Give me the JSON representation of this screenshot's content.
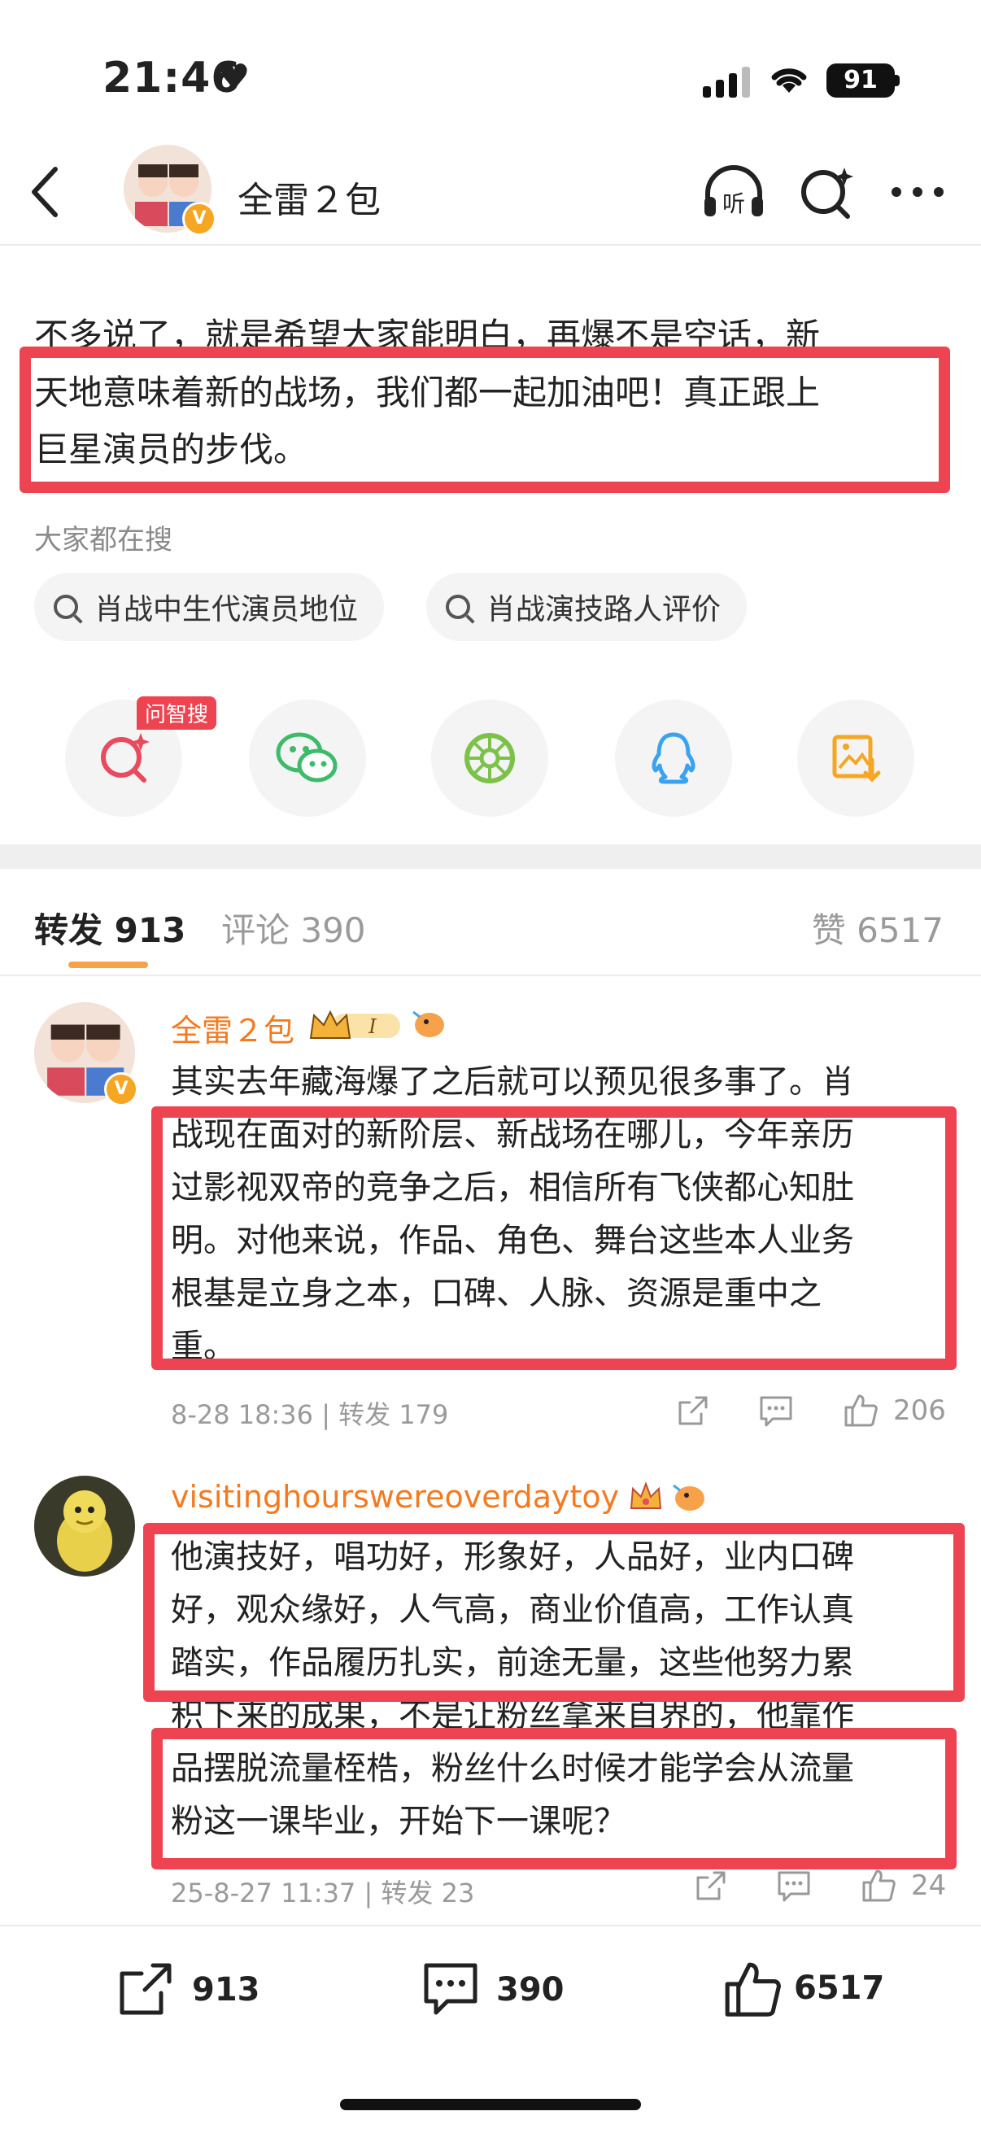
{
  "status": {
    "time": "21:46",
    "battery": "91"
  },
  "header": {
    "title": "全雷２包"
  },
  "post": {
    "lines": [
      "不多说了，就是希望大家能明白，再爆不是空话，新",
      "天地意味着新的战场，我们都一起加油吧！真正跟上",
      "巨星演员的步伐。"
    ]
  },
  "search": {
    "label": "大家都在搜",
    "chips": [
      "肖战中生代演员地位",
      "肖战演技路人评价"
    ]
  },
  "share": {
    "ai_tag": "问智搜"
  },
  "tabs": {
    "repost": "转发 913",
    "comment": "评论 390",
    "like": "赞 6517"
  },
  "comments": [
    {
      "name": "全雷２包",
      "lines": [
        "其实去年藏海爆了之后就可以预见很多事了。肖",
        "战现在面对的新阶层、新战场在哪儿，今年亲历",
        "过影视双帝的竞争之后，相信所有飞侠都心知肚",
        "明。对他来说，作品、角色、舞台这些本人业务",
        "根基是立身之本，口碑、人脉、资源是重中之",
        "重。"
      ],
      "meta": "8-28 18:36 | 转发 179",
      "likes": "206"
    },
    {
      "name": "visitinghourswereoverdaytoy",
      "lines": [
        "他演技好，唱功好，形象好，人品好，业内口碑",
        "好，观众缘好，人气高，商业价值高，工作认真",
        "踏实，作品履历扎实，前途无量，这些他努力累",
        "积下来的成果，不是让粉丝拿来自界的，他靠作",
        "品摆脱流量桎梏，粉丝什么时候才能学会从流量",
        "粉这一课毕业，开始下一课呢？"
      ],
      "meta": "25-8-27 11:37 | 转发 23",
      "likes": "24"
    }
  ],
  "bottom": {
    "repost": "913",
    "comment": "390",
    "like": "6517"
  },
  "colors": {
    "accent": "#f47a20",
    "highlight": "#ee4452",
    "verified": "#f5a623"
  }
}
